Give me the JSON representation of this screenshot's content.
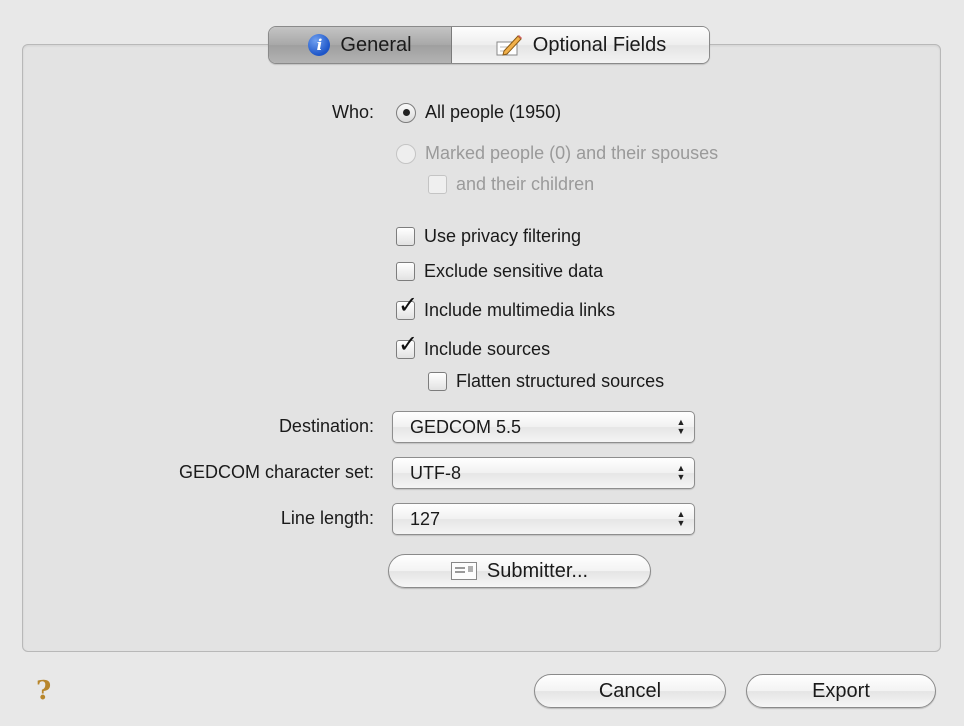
{
  "tabs": [
    {
      "label": "General",
      "icon": "info-icon",
      "selected": true
    },
    {
      "label": "Optional Fields",
      "icon": "pencil-icon",
      "selected": false
    }
  ],
  "who": {
    "label": "Who:",
    "all_people": "All people (1950)",
    "marked_people": "Marked people (0) and their spouses",
    "and_children": "and their children"
  },
  "options": {
    "privacy": "Use privacy filtering",
    "sensitive": "Exclude sensitive data",
    "multimedia": "Include multimedia links",
    "sources": "Include sources",
    "flatten": "Flatten structured sources"
  },
  "fields": {
    "destination_label": "Destination:",
    "destination_value": "GEDCOM 5.5",
    "charset_label": "GEDCOM character set:",
    "charset_value": "UTF-8",
    "line_length_label": "Line length:",
    "line_length_value": "127"
  },
  "submitter_button": "Submitter...",
  "footer": {
    "help": "?",
    "cancel": "Cancel",
    "export": "Export"
  }
}
